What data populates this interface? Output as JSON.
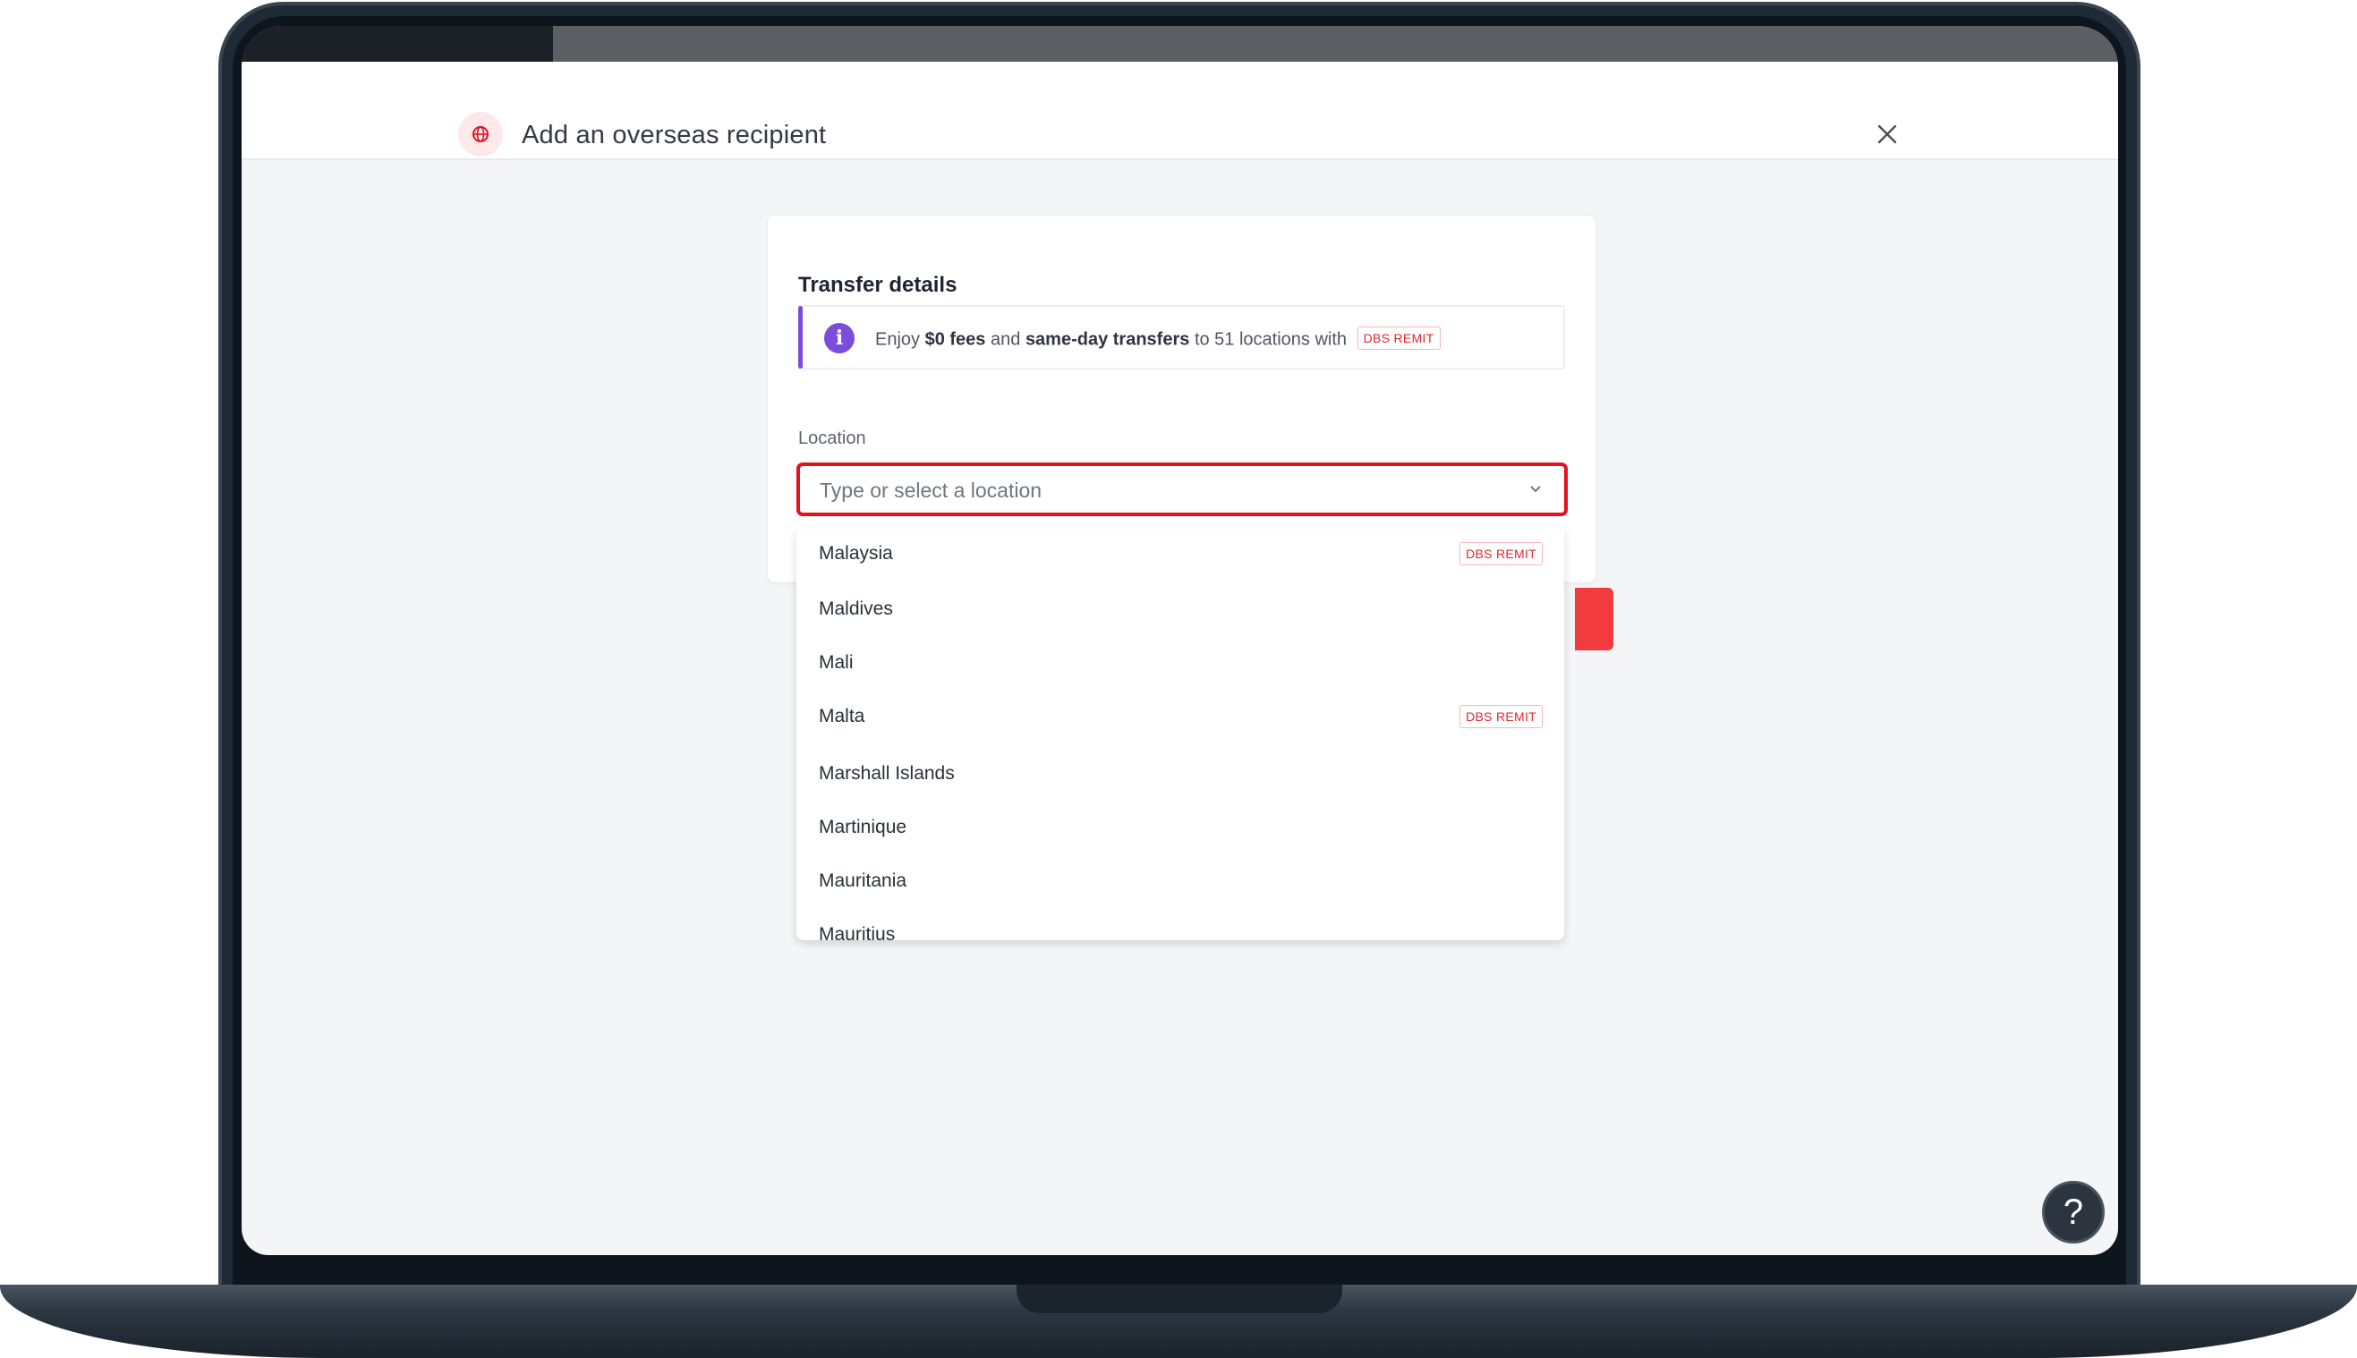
{
  "modal": {
    "title": "Add an overseas recipient",
    "close_icon": "close-icon",
    "header_icon": "globe-icon"
  },
  "transfer_card": {
    "title": "Transfer details",
    "banner": {
      "icon": "info-icon",
      "text_enjoy": "Enjoy",
      "text_fees": "$0 fees",
      "text_and": "and",
      "text_same_day": "same-day transfers",
      "text_rest": "to 51 locations with",
      "badge": "DBS REMIT"
    },
    "location": {
      "label": "Location",
      "placeholder": "Type or select a location"
    }
  },
  "dropdown": {
    "items": [
      {
        "name": "Malaysia",
        "badge": "DBS REMIT"
      },
      {
        "name": "Maldives",
        "badge": ""
      },
      {
        "name": "Mali",
        "badge": ""
      },
      {
        "name": "Malta",
        "badge": "DBS REMIT"
      },
      {
        "name": "Marshall Islands",
        "badge": ""
      },
      {
        "name": "Martinique",
        "badge": ""
      },
      {
        "name": "Mauritania",
        "badge": ""
      },
      {
        "name": "Mauritius",
        "badge": ""
      }
    ]
  },
  "help": {
    "label": "?"
  },
  "colors": {
    "brand_red": "#e3121f",
    "info_purple": "#7c4ddb",
    "badge_red": "#e0262f"
  }
}
